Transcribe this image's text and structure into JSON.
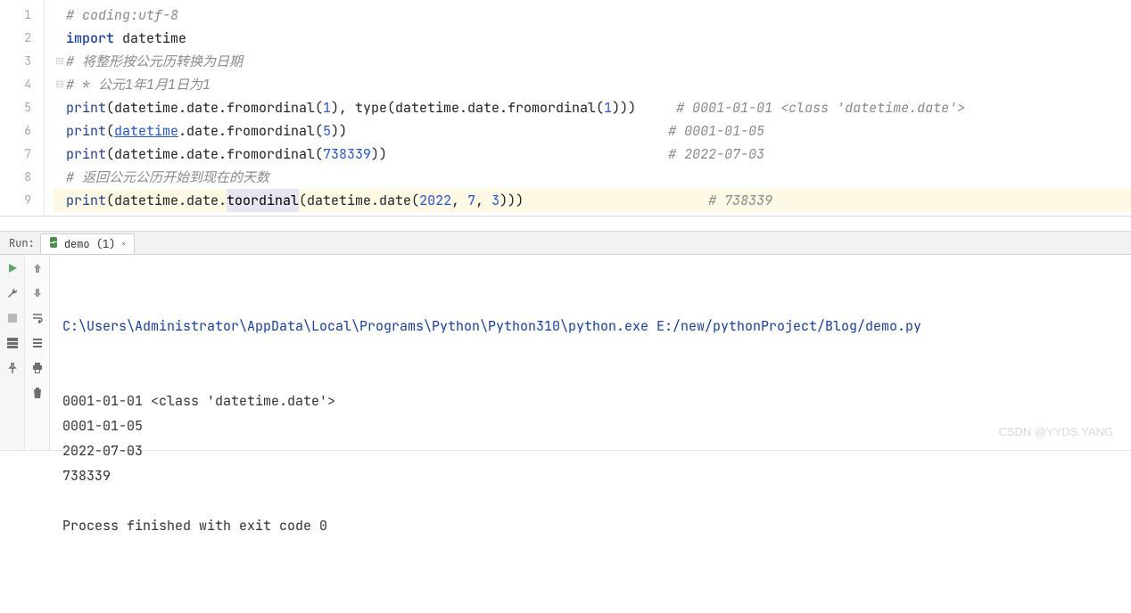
{
  "editor": {
    "lines": [
      {
        "n": 1,
        "fold": "",
        "tokens": [
          {
            "t": "# coding:utf-8",
            "cls": "comment"
          }
        ],
        "current": false
      },
      {
        "n": 2,
        "fold": "",
        "tokens": [
          {
            "t": "import",
            "cls": "keyword"
          },
          {
            "t": " datetime",
            "cls": "plain"
          }
        ],
        "current": false
      },
      {
        "n": 3,
        "fold": "⊟",
        "tokens": [
          {
            "t": "# 将整形按公元历转换为日期",
            "cls": "comment"
          }
        ],
        "current": false
      },
      {
        "n": 4,
        "fold": "⊟",
        "tokens": [
          {
            "t": "# * 公元1年1月1日为1",
            "cls": "comment"
          }
        ],
        "current": false
      },
      {
        "n": 5,
        "fold": "",
        "tokens": [
          {
            "t": "print",
            "cls": "builtin"
          },
          {
            "t": "(datetime.date.fromordinal(",
            "cls": "plain"
          },
          {
            "t": "1",
            "cls": "number"
          },
          {
            "t": "), type(datetime.date.fromordinal(",
            "cls": "plain"
          },
          {
            "t": "1",
            "cls": "number"
          },
          {
            "t": ")))     ",
            "cls": "plain"
          },
          {
            "t": "# 0001-01-01 <class 'datetime.date'>",
            "cls": "comment"
          }
        ],
        "current": false
      },
      {
        "n": 6,
        "fold": "",
        "tokens": [
          {
            "t": "print",
            "cls": "builtin"
          },
          {
            "t": "(",
            "cls": "plain"
          },
          {
            "t": "datetime",
            "cls": "link"
          },
          {
            "t": ".date.fromordinal(",
            "cls": "plain"
          },
          {
            "t": "5",
            "cls": "number"
          },
          {
            "t": "))                                        ",
            "cls": "plain"
          },
          {
            "t": "# 0001-01-05",
            "cls": "comment"
          }
        ],
        "current": false
      },
      {
        "n": 7,
        "fold": "",
        "tokens": [
          {
            "t": "print",
            "cls": "builtin"
          },
          {
            "t": "(datetime.date.fromordinal(",
            "cls": "plain"
          },
          {
            "t": "738339",
            "cls": "number"
          },
          {
            "t": "))                                   ",
            "cls": "plain"
          },
          {
            "t": "# 2022-07-03",
            "cls": "comment"
          }
        ],
        "current": false
      },
      {
        "n": 8,
        "fold": "",
        "tokens": [
          {
            "t": "# 返回公元公历开始到现在的天数",
            "cls": "comment"
          }
        ],
        "current": false
      },
      {
        "n": 9,
        "fold": "",
        "tokens": [
          {
            "t": "print",
            "cls": "builtin"
          },
          {
            "t": "(datetime.date.",
            "cls": "plain"
          },
          {
            "t": "toordinal",
            "cls": "hl-ident"
          },
          {
            "t": "(datetime.date(",
            "cls": "plain"
          },
          {
            "t": "2022",
            "cls": "number"
          },
          {
            "t": ", ",
            "cls": "plain"
          },
          {
            "t": "7",
            "cls": "number"
          },
          {
            "t": ", ",
            "cls": "plain"
          },
          {
            "t": "3",
            "cls": "number"
          },
          {
            "t": ")))                       ",
            "cls": "plain"
          },
          {
            "t": "# 738339",
            "cls": "comment"
          }
        ],
        "current": true
      }
    ]
  },
  "run": {
    "label": "Run:",
    "tab": {
      "name": "demo (1)"
    }
  },
  "console": {
    "cmd": "C:\\Users\\Administrator\\AppData\\Local\\Programs\\Python\\Python310\\python.exe E:/new/pythonProject/Blog/demo.py",
    "lines": [
      "0001-01-01 <class 'datetime.date'>",
      "0001-01-05",
      "2022-07-03",
      "738339",
      "",
      "Process finished with exit code 0"
    ]
  },
  "watermark": "CSDN @YYDS.YANG"
}
